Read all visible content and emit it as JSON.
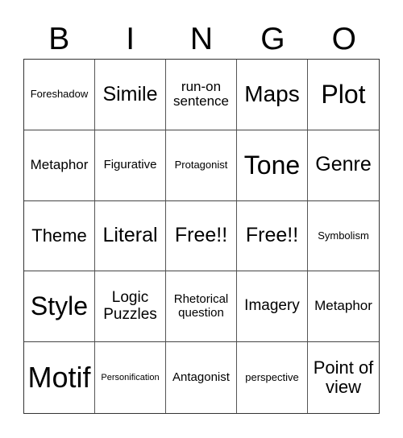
{
  "header": [
    "B",
    "I",
    "N",
    "G",
    "O"
  ],
  "cells": [
    "Foreshadow",
    "Simile",
    "run-on sentence",
    "Maps",
    "Plot",
    "Metaphor",
    "Figurative",
    "Protagonist",
    "Tone",
    "Genre",
    "Theme",
    "Literal",
    "Free!!",
    "Free!!",
    "Symbolism",
    "Style",
    "Logic Puzzles",
    "Rhetorical question",
    "Imagery",
    "Metaphor",
    "Motif",
    "Personification",
    "Antagonist",
    "perspective",
    "Point of view"
  ]
}
